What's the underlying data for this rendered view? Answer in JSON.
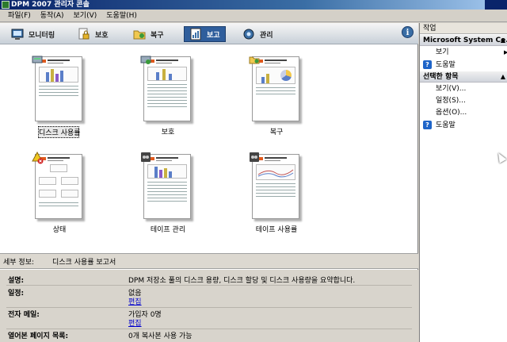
{
  "window": {
    "title": "DPM 2007 관리자 콘솔"
  },
  "menu": [
    "파일(F)",
    "동작(A)",
    "보기(V)",
    "도움말(H)"
  ],
  "nav": {
    "tabs": [
      {
        "label": "모니터링",
        "icon": "monitoring-icon"
      },
      {
        "label": "보호",
        "icon": "protection-lock-icon"
      },
      {
        "label": "복구",
        "icon": "recovery-folder-icon"
      },
      {
        "label": "보고",
        "icon": "reporting-icon",
        "active": true
      },
      {
        "label": "관리",
        "icon": "management-gear-icon"
      }
    ],
    "info_icon": "i"
  },
  "reports": [
    {
      "label": "디스크 사용률",
      "icon": "disk-usage-report-icon",
      "selected": true
    },
    {
      "label": "보호",
      "icon": "protection-report-icon"
    },
    {
      "label": "복구",
      "icon": "recovery-report-icon"
    },
    {
      "label": "상태",
      "icon": "status-warning-error-icon"
    },
    {
      "label": "테이프 관리",
      "icon": "tape-management-report-icon"
    },
    {
      "label": "테이프 사용률",
      "icon": "tape-usage-report-icon"
    }
  ],
  "details": {
    "header_label": "세부 정보:",
    "header_value": "디스크 사용률 보고서",
    "rows": [
      {
        "label": "설명:",
        "value": "DPM 저장소 풀의 디스크 용량, 디스크 할당 및 디스크 사용량을 요약합니다."
      },
      {
        "label": "일정:",
        "value": "없음",
        "link": "편집"
      },
      {
        "label": "전자 메일:",
        "value": "가입자 0명",
        "link": "편집"
      },
      {
        "label": "열어본 페이지 목록:",
        "value": "0개 복사본 사용 가능"
      }
    ]
  },
  "actions": {
    "title": "작업",
    "sections": [
      {
        "title": "Microsoft System Ce...",
        "items": [
          {
            "label": "보기",
            "submenu": true
          },
          {
            "label": "도움말",
            "icon": "help-icon"
          }
        ]
      },
      {
        "title": "선택한 항목",
        "items": [
          {
            "label": "보기(V)..."
          },
          {
            "label": "일정(S)..."
          },
          {
            "label": "옵션(O)..."
          },
          {
            "label": "도움말",
            "icon": "help-icon"
          }
        ]
      }
    ]
  },
  "colors": {
    "title_bar": "#0a246a",
    "active_tab": "#2f5e9c",
    "link": "#0000cc"
  }
}
